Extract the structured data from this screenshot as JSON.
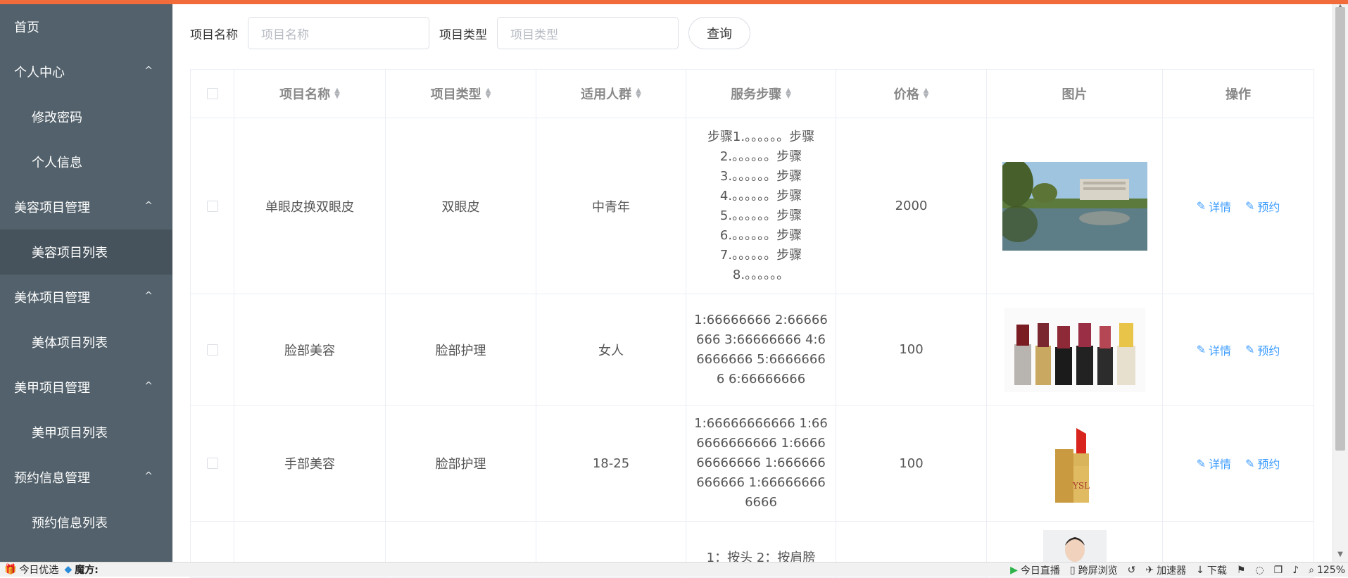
{
  "sidebar": {
    "items": [
      {
        "label": "首页",
        "type": "top"
      },
      {
        "label": "个人中心",
        "type": "group"
      },
      {
        "label": "修改密码",
        "type": "sub"
      },
      {
        "label": "个人信息",
        "type": "sub"
      },
      {
        "label": "美容项目管理",
        "type": "group"
      },
      {
        "label": "美容项目列表",
        "type": "sub",
        "active": true
      },
      {
        "label": "美体项目管理",
        "type": "group"
      },
      {
        "label": "美体项目列表",
        "type": "sub"
      },
      {
        "label": "美甲项目管理",
        "type": "group"
      },
      {
        "label": "美甲项目列表",
        "type": "sub"
      },
      {
        "label": "预约信息管理",
        "type": "group"
      },
      {
        "label": "预约信息列表",
        "type": "sub"
      }
    ]
  },
  "search": {
    "name_label": "项目名称",
    "name_placeholder": "项目名称",
    "type_label": "项目类型",
    "type_placeholder": "项目类型",
    "query_button": "查询"
  },
  "table": {
    "headers": [
      "项目名称",
      "项目类型",
      "适用人群",
      "服务步骤",
      "价格",
      "图片",
      "操作"
    ],
    "rows": [
      {
        "name": "单眼皮换双眼皮",
        "type": "双眼皮",
        "crowd": "中青年",
        "steps": "步骤1.。。。。。。步骤2.。。。。。。步骤3.。。。。。。步骤4.。。。。。。步骤5.。。。。。。步骤6.。。。。。。步骤7.。。。。。。步骤8.。。。。。。",
        "price": "2000",
        "image": "lake-campus-photo"
      },
      {
        "name": "脸部美容",
        "type": "脸部护理",
        "crowd": "女人",
        "steps": "1:66666666 2:66666666 3:66666666 4:66666666 5:66666666 6:66666666",
        "price": "100",
        "image": "lipsticks-photo"
      },
      {
        "name": "手部美容",
        "type": "脸部护理",
        "crowd": "18-25",
        "steps": "1:66666666666 1:666666666666 1:666666666666 1:666666666666 1:666666666666",
        "price": "100",
        "image": "red-lipstick-photo"
      },
      {
        "name": "",
        "type": "",
        "crowd": "",
        "steps": "1：按头 2：按肩膀",
        "price": "",
        "image": "person-photo"
      }
    ],
    "detail_label": "详情",
    "book_label": "预约"
  },
  "bottombar": {
    "left": [
      "今日优选",
      "魔方:"
    ],
    "right": [
      "今日直播",
      "跨屏浏览",
      "加速器",
      "下载",
      "125%"
    ]
  },
  "colors": {
    "accent": "#f26b3a",
    "sidebar": "#52616b",
    "link": "#409eff"
  }
}
